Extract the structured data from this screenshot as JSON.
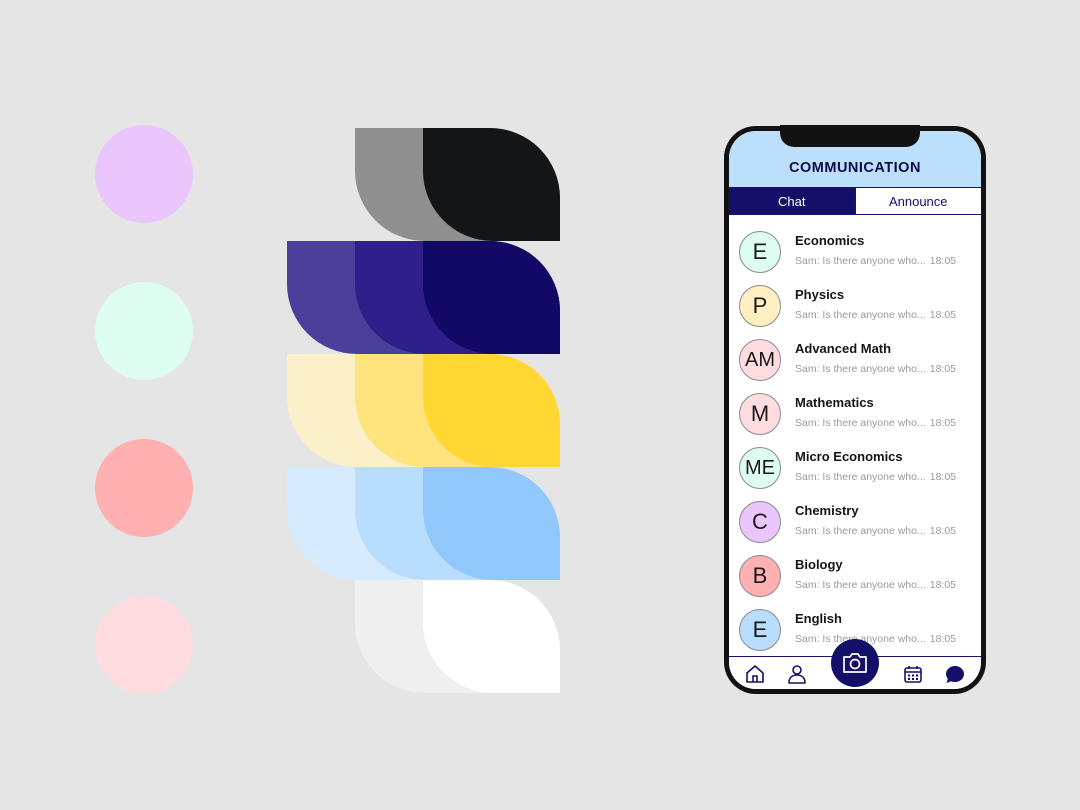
{
  "palette": {
    "dots": [
      "#ebc6fc",
      "#dcfdf0",
      "#ffb0b0",
      "#ffdcdf"
    ],
    "rows": [
      [
        "#8f8f8f",
        "#141517"
      ],
      [
        "#4a409b",
        "#2e1f8a",
        "#120967"
      ],
      [
        "#fcf0cb",
        "#ffe37d",
        "#ffd632"
      ],
      [
        "#d6ebfd",
        "#b9ddfd",
        "#90c8fb"
      ],
      [
        "#efefef",
        "#ffffff"
      ]
    ]
  },
  "app": {
    "title": "COMMUNICATION",
    "tabs": [
      {
        "label": "Chat",
        "active": true
      },
      {
        "label": "Announce",
        "active": false
      }
    ],
    "chats": [
      {
        "initial": "E",
        "name": "Economics",
        "preview": "Sam: Is there anyone who...",
        "time": "18:05",
        "color": "#dcfdf0"
      },
      {
        "initial": "P",
        "name": "Physics",
        "preview": "Sam: Is there anyone who...",
        "time": "18:05",
        "color": "#ffefc2"
      },
      {
        "initial": "AM",
        "name": "Advanced Math",
        "preview": "Sam: Is there anyone who...",
        "time": "18:05",
        "color": "#ffdcdf"
      },
      {
        "initial": "M",
        "name": "Mathematics",
        "preview": "Sam: Is there anyone who...",
        "time": "18:05",
        "color": "#ffdcdf"
      },
      {
        "initial": "ME",
        "name": "Micro Economics",
        "preview": "Sam: Is there anyone who...",
        "time": "18:05",
        "color": "#dcfdf0"
      },
      {
        "initial": "C",
        "name": "Chemistry",
        "preview": "Sam: Is there anyone who...",
        "time": "18:05",
        "color": "#ebc6fc"
      },
      {
        "initial": "B",
        "name": "Biology",
        "preview": "Sam: Is there anyone who...",
        "time": "18:05",
        "color": "#ffb0b0"
      },
      {
        "initial": "E",
        "name": "English",
        "preview": "Sam: Is there anyone who...",
        "time": "18:05",
        "color": "#b9ddfd"
      }
    ],
    "nav": [
      "home-icon",
      "profile-icon",
      "camera-icon",
      "calendar-icon",
      "chat-bubble-icon"
    ],
    "accent": "#14106a",
    "header_color": "#bcdffb"
  }
}
